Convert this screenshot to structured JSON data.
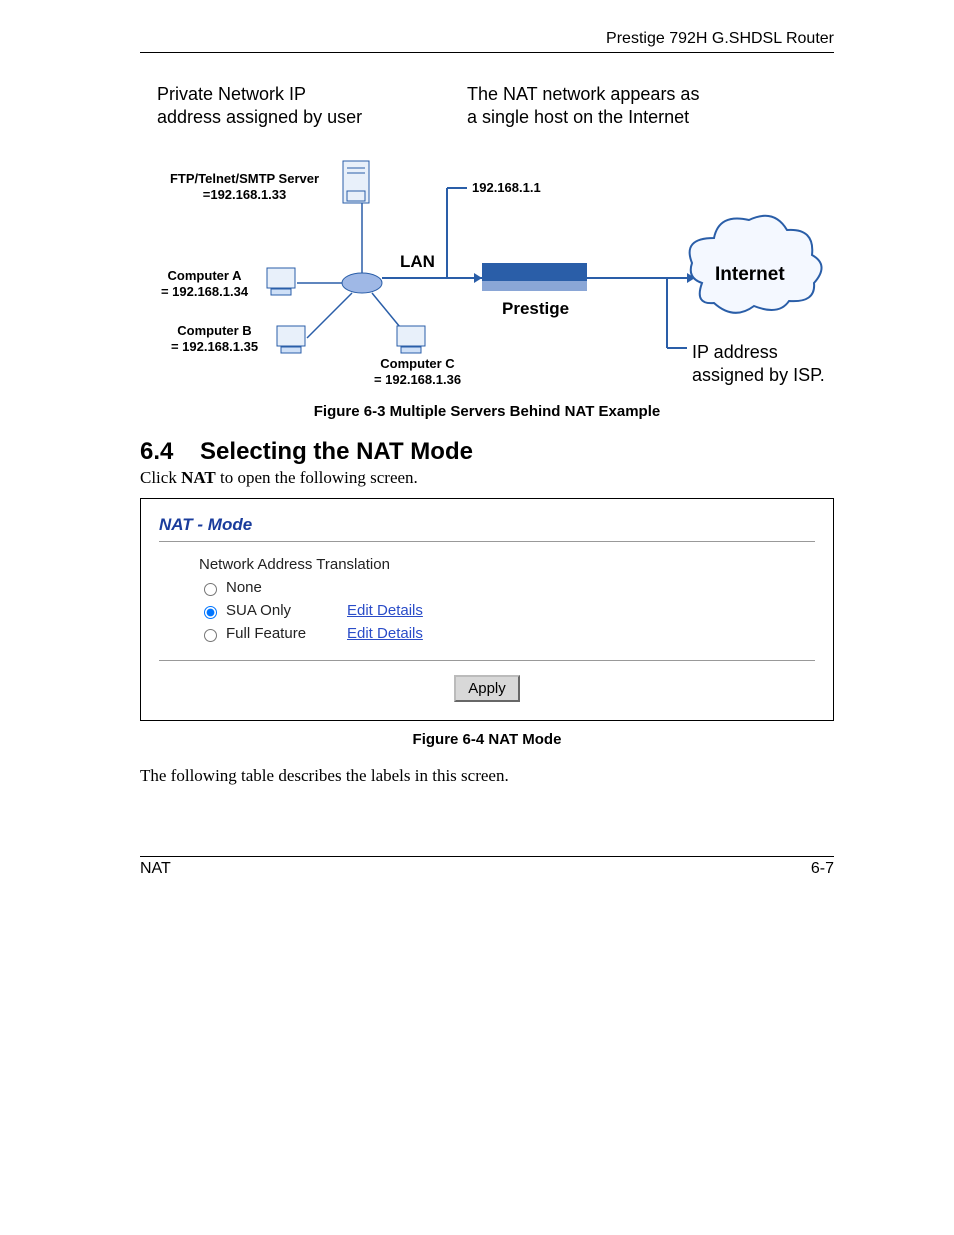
{
  "header": {
    "product": "Prestige 792H G.SHDSL Router"
  },
  "diagram": {
    "left_note": "Private Network IP\naddress assigned by user",
    "right_note": "The NAT network appears as\na single host on the Internet",
    "server_label": "FTP/Telnet/SMTP Server\n=192.168.1.33",
    "comp_a": "Computer A\n= 192.168.1.34",
    "comp_b": "Computer B\n= 192.168.1.35",
    "comp_c": "Computer C\n= 192.168.1.36",
    "router_ip": "192.168.1.1",
    "lan_label": "LAN",
    "prestige_label": "Prestige",
    "internet_label": "Internet",
    "isp_note": "IP address\nassigned by ISP."
  },
  "fig1_caption": "Figure 6-3 Multiple Servers Behind NAT Example",
  "section": {
    "num": "6.4",
    "title": "Selecting the NAT Mode"
  },
  "intro_pre": "Click ",
  "intro_bold": "NAT",
  "intro_post": " to open the following screen.",
  "screen": {
    "title": "NAT - Mode",
    "group_label": "Network Address Translation",
    "options": {
      "none": "None",
      "sua": "SUA Only",
      "full": "Full Feature"
    },
    "edit_link": "Edit Details",
    "apply": "Apply"
  },
  "fig2_caption": "Figure 6-4 NAT Mode",
  "after_text": "The following table describes the labels in this screen.",
  "footer": {
    "left": "NAT",
    "right": "6-7"
  }
}
